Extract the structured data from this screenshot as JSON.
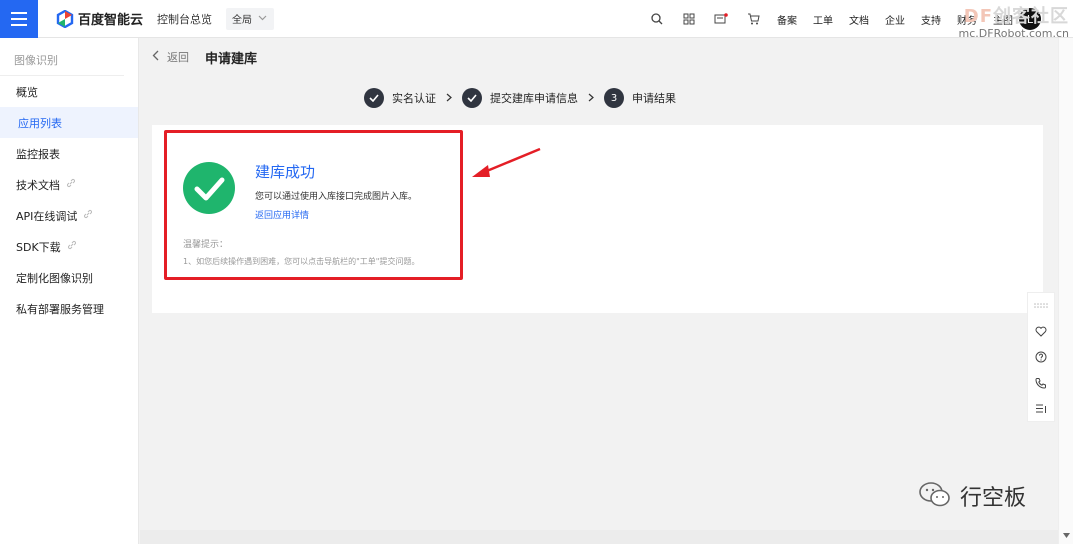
{
  "topbar": {
    "brand": "百度智能云",
    "console_overview": "控制台总览",
    "scope": "全局",
    "links": [
      "备案",
      "工单",
      "文档",
      "企业",
      "支持",
      "财务"
    ],
    "partial_link": "主图",
    "avatar": "L"
  },
  "watermark": {
    "title_df": "DF",
    "title_rest": "创客社区",
    "sub": "mc.DFRobot.com.cn"
  },
  "sidebar": {
    "header": "图像识别",
    "items": [
      {
        "label": "概览"
      },
      {
        "label": "应用列表"
      },
      {
        "label": "监控报表"
      },
      {
        "label": "技术文档"
      },
      {
        "label": "API在线调试"
      },
      {
        "label": "SDK下载"
      },
      {
        "label": "定制化图像识别"
      },
      {
        "label": "私有部署服务管理"
      }
    ]
  },
  "page": {
    "back": "返回",
    "title": "申请建库"
  },
  "steps": [
    {
      "label": "实名认证",
      "state": "done"
    },
    {
      "label": "提交建库申请信息",
      "state": "done"
    },
    {
      "label": "申请结果",
      "number": "3",
      "state": "current"
    }
  ],
  "result": {
    "title": "建库成功",
    "desc": "您可以通过使用入库接口完成图片入库。",
    "link": "返回应用详情",
    "tips_head": "温馨提示：",
    "tips_body": "1、如您后续操作遇到困难，您可以点击导航栏的\"工单\"提交问题。"
  },
  "wechat": {
    "account": "行空板"
  },
  "colors": {
    "primary": "#2468f2",
    "success": "#1fb56d",
    "highlight": "#e41e26",
    "step_dark": "#303540"
  },
  "icons": [
    "menu-icon",
    "search-icon",
    "grid-icon",
    "message-icon",
    "cart-icon",
    "check-icon",
    "link-icon",
    "chat-icon",
    "help-icon",
    "phone-icon",
    "list-icon",
    "wechat-icon"
  ]
}
